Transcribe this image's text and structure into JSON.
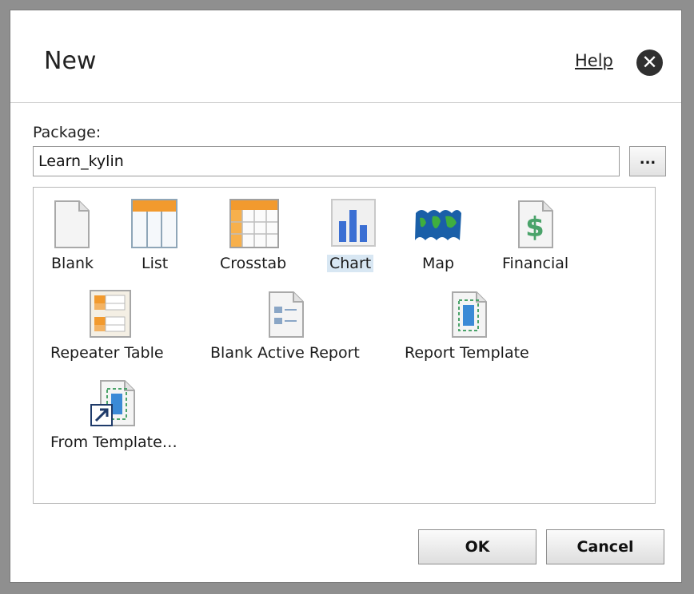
{
  "dialog": {
    "title": "New",
    "help_label": "Help",
    "close_glyph": "✕"
  },
  "package": {
    "label": "Package:",
    "value": "Learn_kylin",
    "browse_label": "..."
  },
  "items": [
    {
      "label": "Blank",
      "icon": "blank-page-icon"
    },
    {
      "label": "List",
      "icon": "list-table-icon"
    },
    {
      "label": "Crosstab",
      "icon": "crosstab-icon"
    },
    {
      "label": "Chart",
      "icon": "bar-chart-icon",
      "selected": true
    },
    {
      "label": "Map",
      "icon": "map-icon"
    },
    {
      "label": "Financial",
      "icon": "financial-icon"
    },
    {
      "label": "Repeater Table",
      "icon": "repeater-table-icon"
    },
    {
      "label": "Blank Active Report",
      "icon": "active-report-icon"
    },
    {
      "label": "Report Template",
      "icon": "report-template-icon"
    },
    {
      "label": "From Template…",
      "icon": "from-template-icon"
    }
  ],
  "buttons": {
    "ok": "OK",
    "cancel": "Cancel"
  },
  "colors": {
    "selection": "#d8e7f3",
    "orange": "#f29a2e",
    "chart_blue": "#3b6fd3"
  }
}
